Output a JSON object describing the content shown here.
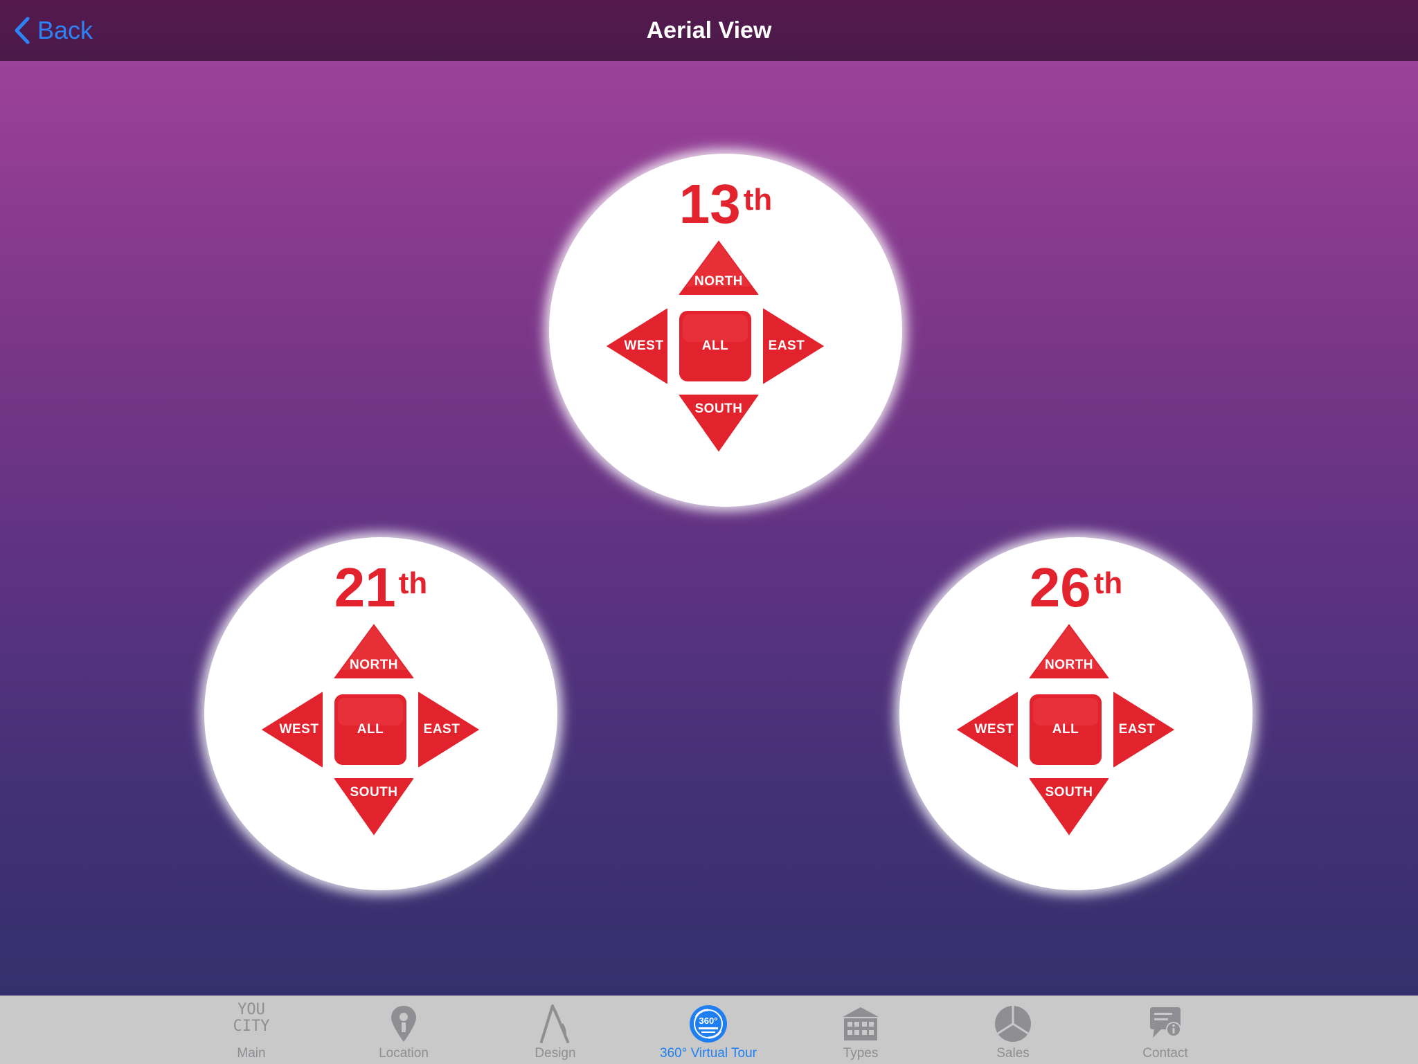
{
  "navbar": {
    "back_label": "Back",
    "title": "Aerial View"
  },
  "dials": [
    {
      "floor_number": "13",
      "floor_suffix": "th",
      "north": "NORTH",
      "west": "WEST",
      "all": "ALL",
      "east": "EAST",
      "south": "SOUTH"
    },
    {
      "floor_number": "21",
      "floor_suffix": "th",
      "north": "NORTH",
      "west": "WEST",
      "all": "ALL",
      "east": "EAST",
      "south": "SOUTH"
    },
    {
      "floor_number": "26",
      "floor_suffix": "th",
      "north": "NORTH",
      "west": "WEST",
      "all": "ALL",
      "east": "EAST",
      "south": "SOUTH"
    }
  ],
  "tabbar": {
    "items": [
      {
        "label": "Main",
        "icon": "youcity-logo-icon",
        "logo_text": "YOU CITY"
      },
      {
        "label": "Location",
        "icon": "map-pin-icon"
      },
      {
        "label": "Design",
        "icon": "compass-drafting-icon"
      },
      {
        "label": "360° Virtual Tour",
        "icon": "virtual-tour-360-icon",
        "active": true
      },
      {
        "label": "Types",
        "icon": "building-icon"
      },
      {
        "label": "Sales",
        "icon": "pie-chart-icon"
      },
      {
        "label": "Contact",
        "icon": "chat-bubble-info-icon"
      }
    ]
  },
  "colors": {
    "accent": "#e2232d",
    "tab_active": "#1f7ff0",
    "tab_inactive": "#8e8e93",
    "back_link": "#2d82f6",
    "navbar_bg": "#4e1a4b"
  }
}
